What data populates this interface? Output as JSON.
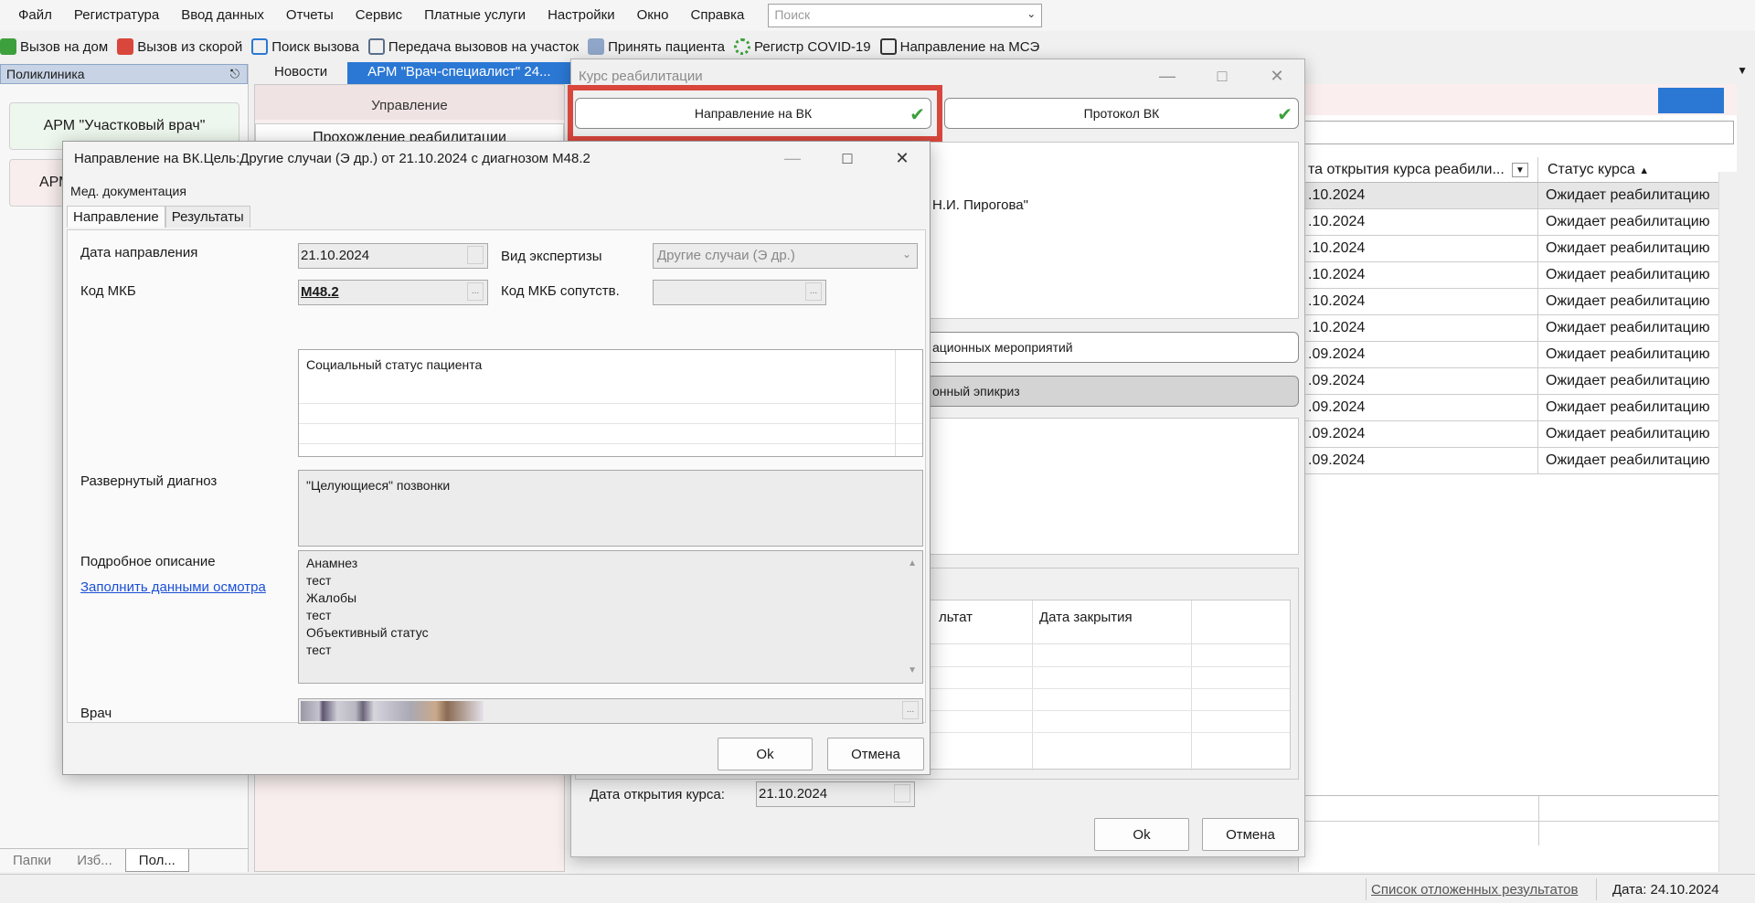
{
  "menu": {
    "items": [
      "Файл",
      "Регистратура",
      "Ввод данных",
      "Отчеты",
      "Сервис",
      "Платные услуги",
      "Настройки",
      "Окно",
      "Справка"
    ],
    "search_placeholder": "Поиск"
  },
  "toolbar": {
    "items": [
      {
        "label": "Вызов на дом",
        "icon": "home-call-icon",
        "color": "#3ca03c"
      },
      {
        "label": "Вызов из скорой",
        "icon": "ambulance-icon",
        "color": "#d9463c"
      },
      {
        "label": "Поиск вызова",
        "icon": "search-call-icon",
        "color": "#2b78d4"
      },
      {
        "label": "Передача вызовов на участок",
        "icon": "transfer-icon",
        "color": "#2b78d4"
      },
      {
        "label": "Принять пациента",
        "icon": "patient-icon",
        "color": "#5a6f8a"
      },
      {
        "label": "Регистр COVID-19",
        "icon": "covid-icon",
        "color": "#3ca03c"
      },
      {
        "label": "Направление на МСЭ",
        "icon": "mse-icon",
        "color": "#333333"
      }
    ]
  },
  "left_panel": {
    "title": "Поликлиника",
    "arm_buttons": [
      "АРМ \"Участковый врач\"",
      "АРМ"
    ],
    "bottom_tabs": [
      "Папки",
      "Изб...",
      "Пол..."
    ]
  },
  "tabs": {
    "items": [
      "Новости",
      "АРМ \"Врач-специалист\" 24..."
    ]
  },
  "center": {
    "management": "Управление",
    "rehab_pass": "Прохождение реабилитации"
  },
  "grid": {
    "col1": "та открытия курса реабили...",
    "col2": "Статус курса",
    "rows": [
      {
        "date": ".10.2024",
        "status": "Ожидает реабилитацию"
      },
      {
        "date": ".10.2024",
        "status": "Ожидает реабилитацию"
      },
      {
        "date": ".10.2024",
        "status": "Ожидает реабилитацию"
      },
      {
        "date": ".10.2024",
        "status": "Ожидает реабилитацию"
      },
      {
        "date": ".10.2024",
        "status": "Ожидает реабилитацию"
      },
      {
        "date": ".10.2024",
        "status": "Ожидает реабилитацию"
      },
      {
        "date": ".09.2024",
        "status": "Ожидает реабилитацию"
      },
      {
        "date": ".09.2024",
        "status": "Ожидает реабилитацию"
      },
      {
        "date": ".09.2024",
        "status": "Ожидает реабилитацию"
      },
      {
        "date": ".09.2024",
        "status": "Ожидает реабилитацию"
      },
      {
        "date": ".09.2024",
        "status": "Ожидает реабилитацию"
      }
    ]
  },
  "statusbar": {
    "pending": "Список отложенных результатов",
    "date": "Дата: 24.10.2024"
  },
  "rehab_dialog": {
    "title": "Курс реабилитации",
    "vk_button": "Направление на ВК",
    "protocol_button": "Протокол ВК",
    "org_text": "Н.И. Пирогова\"",
    "measures_button": "ационных мероприятий",
    "epicrisis_button": "онный эпикриз",
    "col_result": "льтат",
    "col_close_date": "Дата закрытия",
    "open_date_label": "Дата открытия курса:",
    "open_date_value": "21.10.2024",
    "ok": "Ok",
    "cancel": "Отмена"
  },
  "vk_dialog": {
    "title": "Направление на ВК.Цель:Другие случаи (Э др.) от 21.10.2024 с диагнозом М48.2",
    "med_docs": "Мед. документация",
    "tab_direction": "Направление",
    "tab_results": "Результаты",
    "date_label": "Дата направления",
    "date_value": "21.10.2024",
    "expertise_label": "Вид экспертизы",
    "expertise_value": "Другие случаи (Э др.)",
    "mkb_label": "Код МКБ",
    "mkb_value": "M48.2",
    "mkb_co_label": "Код МКБ сопутств.",
    "social_status": "Социальный статус пациента",
    "diag_label": "Развернутый диагноз",
    "diag_value": "\"Целующиеся\" позвонки",
    "desc_label": "Подробное описание",
    "fill_link": "Заполнить данными осмотра",
    "desc_lines": [
      "Анамнез",
      "тест",
      "Жалобы",
      "тест",
      "Объективный статус",
      "тест"
    ],
    "doctor_label": "Врач",
    "ok": "Ok",
    "cancel": "Отмена"
  }
}
